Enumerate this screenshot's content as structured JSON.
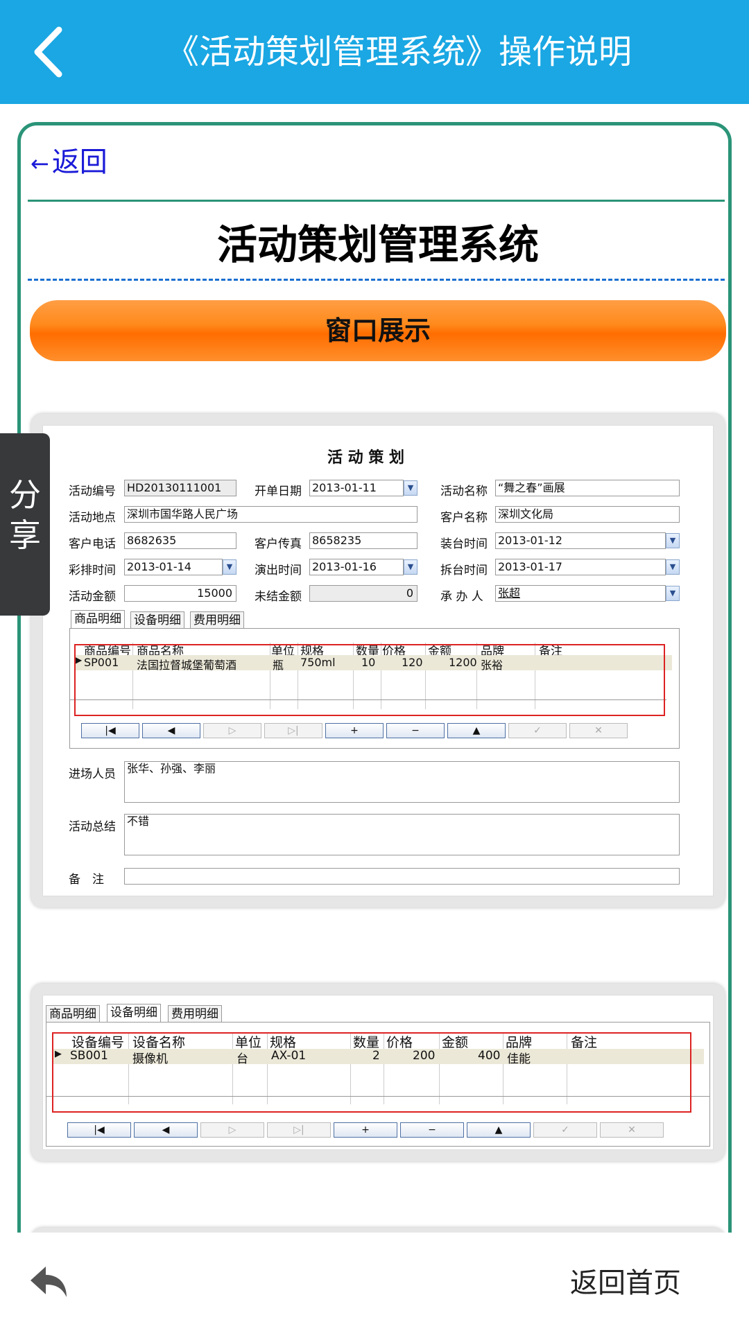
{
  "header": {
    "title": "《活动策划管理系统》操作说明"
  },
  "content": {
    "back_link": "返回",
    "heading": "活动策划管理系统",
    "section_bar": "窗口展示"
  },
  "screenshot1": {
    "form_title": "活 动 策 划",
    "labels": {
      "activity_no": "活动编号",
      "open_date": "开单日期",
      "activity_name": "活动名称",
      "activity_place": "活动地点",
      "customer_name": "客户名称",
      "customer_phone": "客户电话",
      "customer_fax": "客户传真",
      "setup_time": "装台时间",
      "rehearsal_time": "彩排时间",
      "show_time": "演出时间",
      "teardown_time": "拆台时间",
      "amount": "活动金额",
      "unsettled": "未结金额",
      "handler": "承 办 人",
      "staff": "进场人员",
      "summary": "活动总结",
      "remark": "备　注"
    },
    "values": {
      "activity_no": "HD20130111001",
      "open_date": "2013-01-11",
      "activity_name": "“舞之春”画展",
      "activity_place": "深圳市国华路人民广场",
      "customer_name": "深圳文化局",
      "customer_phone": "8682635",
      "customer_fax": "8658235",
      "setup_time": "2013-01-12",
      "rehearsal_time": "2013-01-14",
      "show_time": "2013-01-16",
      "teardown_time": "2013-01-17",
      "amount": "15000",
      "unsettled": "0",
      "handler": "张超",
      "staff": "张华、孙强、李丽",
      "summary": "不错",
      "remark": ""
    },
    "tabs": [
      "商品明细",
      "设备明细",
      "费用明细"
    ],
    "table_headers": [
      "商品编号",
      "商品名称",
      "单位",
      "规格",
      "数量",
      "价格",
      "金额",
      "品牌",
      "备注"
    ],
    "table_row": [
      "SP001",
      "法国拉督城堡葡萄酒",
      "瓶",
      "750ml",
      "10",
      "120",
      "1200",
      "张裕",
      ""
    ]
  },
  "screenshot2": {
    "tabs": [
      "商品明细",
      "设备明细",
      "费用明细"
    ],
    "table_headers": [
      "设备编号",
      "设备名称",
      "单位",
      "规格",
      "数量",
      "价格",
      "金额",
      "品牌",
      "备注"
    ],
    "table_row": [
      "SB001",
      "摄像机",
      "台",
      "AX-01",
      "2",
      "200",
      "400",
      "佳能",
      ""
    ]
  },
  "nav_buttons": [
    "|◀",
    "◀",
    "▷",
    "▷|",
    "+",
    "−",
    "▲",
    "✓",
    "✕"
  ],
  "share": {
    "label_1": "分",
    "label_2": "享"
  },
  "footer": {
    "home_label": "返回首页"
  },
  "icons": {
    "back": "chevron-left-icon",
    "reply": "reply-arrow-icon"
  },
  "colors": {
    "header": "#1aa7e3",
    "border": "#2b9478",
    "accent_orange": "#ff7a00",
    "link": "#1a1ad8"
  }
}
